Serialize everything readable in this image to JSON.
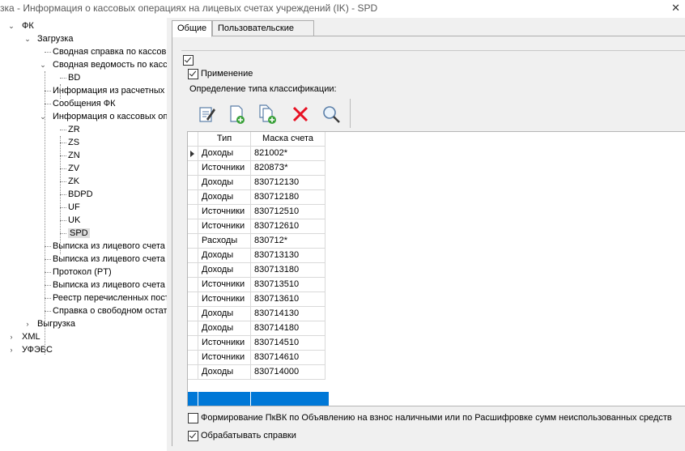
{
  "window": {
    "title": "зка - Информация о кассовых операциях на лицевых счетах учреждений (IK) - SPD"
  },
  "tree": {
    "nodes": [
      {
        "label": "ФК",
        "expanded": true
      },
      {
        "label": "Загрузка",
        "expanded": true
      },
      {
        "label": "Сводная справка по кассов"
      },
      {
        "label": "Сводная ведомость по касс",
        "expanded": true
      },
      {
        "label": "BD"
      },
      {
        "label": "Информация из расчетных"
      },
      {
        "label": "Сообщения ФК"
      },
      {
        "label": "Информация о кассовых оп",
        "expanded": true
      },
      {
        "label": "ZR"
      },
      {
        "label": "ZS"
      },
      {
        "label": "ZN"
      },
      {
        "label": "ZV"
      },
      {
        "label": "ZK"
      },
      {
        "label": "BDPD"
      },
      {
        "label": "UF"
      },
      {
        "label": "UK"
      },
      {
        "label": "SPD",
        "selected": true
      },
      {
        "label": "Выписка из лицевого счета"
      },
      {
        "label": "Выписка из лицевого счета"
      },
      {
        "label": "Протокол (PT)"
      },
      {
        "label": "Выписка из лицевого счета"
      },
      {
        "label": "Реестр перечисленных пост"
      },
      {
        "label": "Справка о свободном остат"
      },
      {
        "label": "Выгрузка",
        "expanded": false
      },
      {
        "label": "XML",
        "expanded": false
      },
      {
        "label": "УФЭБС",
        "expanded": false
      }
    ]
  },
  "tabs": [
    {
      "label": "Общие",
      "active": true
    },
    {
      "label": "Пользовательские",
      "active": false
    }
  ],
  "settings": {
    "top_checkbox_checked": true,
    "apply_label": "Применение",
    "apply_checked": true,
    "classification_label": "Определение типа классификации:",
    "form_pkvk_label": "Формирование ПкВК по Объявлению на взнос наличными или по Расшифровке сумм неиспользованных средств",
    "form_pkvk_checked": false,
    "process_refs_label": "Обрабатывать справки",
    "process_refs_checked": true
  },
  "toolbar": {
    "buttons": [
      {
        "icon": "edit-icon"
      },
      {
        "icon": "add-document-icon"
      },
      {
        "icon": "copy-document-icon"
      },
      {
        "icon": "delete-icon"
      },
      {
        "icon": "search-icon"
      }
    ]
  },
  "grid": {
    "columns": [
      "Тип",
      "Маска счета"
    ],
    "rows": [
      [
        "Доходы",
        "821002*"
      ],
      [
        "Источники",
        "82087З*"
      ],
      [
        "Доходы",
        "830712130"
      ],
      [
        "Доходы",
        "830712180"
      ],
      [
        "Источники",
        "830712510"
      ],
      [
        "Источники",
        "830712610"
      ],
      [
        "Расходы",
        "830712*"
      ],
      [
        "Доходы",
        "830713130"
      ],
      [
        "Доходы",
        "830713180"
      ],
      [
        "Источники",
        "830713510"
      ],
      [
        "Источники",
        "830713610"
      ],
      [
        "Доходы",
        "830714130"
      ],
      [
        "Доходы",
        "830714180"
      ],
      [
        "Источники",
        "830714510"
      ],
      [
        "Источники",
        "830714610"
      ],
      [
        "Доходы",
        "830714000"
      ]
    ],
    "current_row": 0
  },
  "colors": {
    "new_row_highlight": "#0078d7",
    "delete_icon": "#e81123"
  }
}
